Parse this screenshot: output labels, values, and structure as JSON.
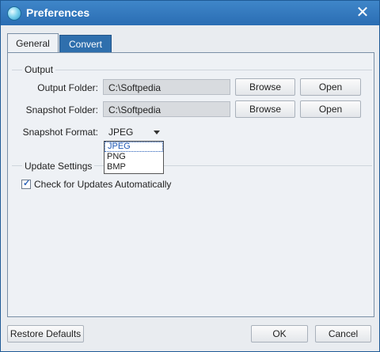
{
  "window": {
    "title": "Preferences",
    "app_icon": "app-icon",
    "close_icon": "close-icon"
  },
  "tabs": [
    {
      "label": "General",
      "active": true
    },
    {
      "label": "Convert",
      "active": false
    }
  ],
  "output": {
    "section_label": "Output",
    "output_folder": {
      "label": "Output Folder:",
      "value": "C:\\Softpedia",
      "browse": "Browse",
      "open": "Open"
    },
    "snapshot_folder": {
      "label": "Snapshot Folder:",
      "value": "C:\\Softpedia",
      "browse": "Browse",
      "open": "Open"
    },
    "snapshot_format": {
      "label": "Snapshot Format:",
      "selected": "JPEG",
      "options": [
        "JPEG",
        "PNG",
        "BMP"
      ]
    }
  },
  "update": {
    "section_label": "Update Settings",
    "check_label": "Check for Updates Automatically",
    "checked": true
  },
  "footer": {
    "restore": "Restore Defaults",
    "ok": "OK",
    "cancel": "Cancel"
  },
  "colors": {
    "titlebar": "#2f74bb",
    "active_tab": "#eef1f5",
    "inactive_tab": "#2f6fad",
    "selection": "#1c57b5"
  }
}
